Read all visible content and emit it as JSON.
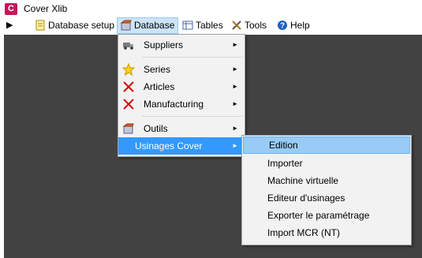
{
  "window": {
    "title": "Cover Xlib",
    "app_icon": "C"
  },
  "menubar": {
    "play_glyph": "▶",
    "items": [
      {
        "label": "Database setup",
        "icon": "document-icon"
      },
      {
        "label": "Database",
        "icon": "database-icon"
      },
      {
        "label": "Tables",
        "icon": "table-icon"
      },
      {
        "label": "Tools",
        "icon": "tools-icon"
      },
      {
        "label": "Help",
        "icon": "help-icon"
      }
    ]
  },
  "database_menu": {
    "items": [
      {
        "label": "Suppliers",
        "icon": "truck-icon"
      },
      {
        "label": "Series",
        "icon": "star-icon"
      },
      {
        "label": "Articles",
        "icon": "cross-icon"
      },
      {
        "label": "Manufacturing",
        "icon": "cross-icon"
      },
      {
        "label": "Outils",
        "icon": "database-icon"
      },
      {
        "label": "Usinages Cover",
        "icon": ""
      }
    ],
    "submenu_arrow": "►"
  },
  "usinages_menu": {
    "items": [
      "Edition",
      "Importer",
      "Machine virtuelle",
      "Editeur d'usinages",
      "Exporter le paramétrage",
      "Import MCR (NT)"
    ]
  },
  "colors": {
    "workspace": "#424242",
    "highlight": "#3399ff",
    "hover": "#98cbf5",
    "app_icon": "#c2185b"
  }
}
